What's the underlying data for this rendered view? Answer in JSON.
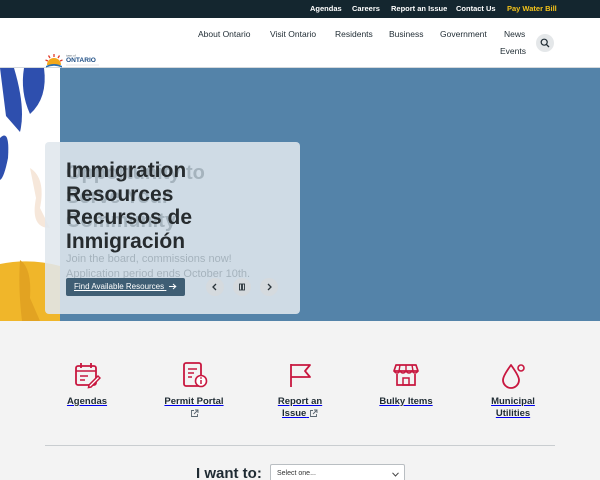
{
  "utility_bar": {
    "links": [
      "Agendas",
      "Careers",
      "Report an Issue",
      "Contact Us"
    ],
    "pay_bill": "Pay Water Bill",
    "pay_color": "#f3c21a",
    "bg_color": "#14262f"
  },
  "header": {
    "logo_small": "town of",
    "logo_text": "ONTARIO",
    "nav": [
      "About Ontario",
      "Visit Ontario",
      "Residents",
      "Business",
      "Government",
      "News",
      "Events"
    ],
    "search_icon": "search-icon"
  },
  "hero": {
    "bg_color": "#5483a9",
    "ghost_title_line1": "Opportunity to",
    "ghost_title_line2": "Serve Your",
    "ghost_title_line3": "Community",
    "ghost_body_line1": "Join the board, commissions now!",
    "ghost_body_line2": "Application period ends October 10th.",
    "title_line1": "Immigration",
    "title_line2": "Resources",
    "title_line3": "Recursos de",
    "title_line4": "Inmigración",
    "cta": "Find Available Resources",
    "cta_icon": "arrow-right-icon",
    "controls": [
      "chevron-left-icon",
      "pause-icon",
      "chevron-right-icon"
    ]
  },
  "quick_links": {
    "accent_color": "#c8173f",
    "items": [
      {
        "label": "Agendas",
        "icon": "calendar-edit-icon"
      },
      {
        "label": "Permit Portal",
        "icon": "document-info-icon",
        "external": true
      },
      {
        "label_line1": "Report an",
        "label_line2": "Issue",
        "icon": "flag-icon",
        "external": true
      },
      {
        "label": "Bulky Items",
        "icon": "store-icon"
      },
      {
        "label_line1": "Municipal",
        "label_line2": "Utilities",
        "icon": "water-drop-icon"
      }
    ]
  },
  "i_want_to": {
    "label": "I want to:",
    "select_value": "Select one..."
  }
}
